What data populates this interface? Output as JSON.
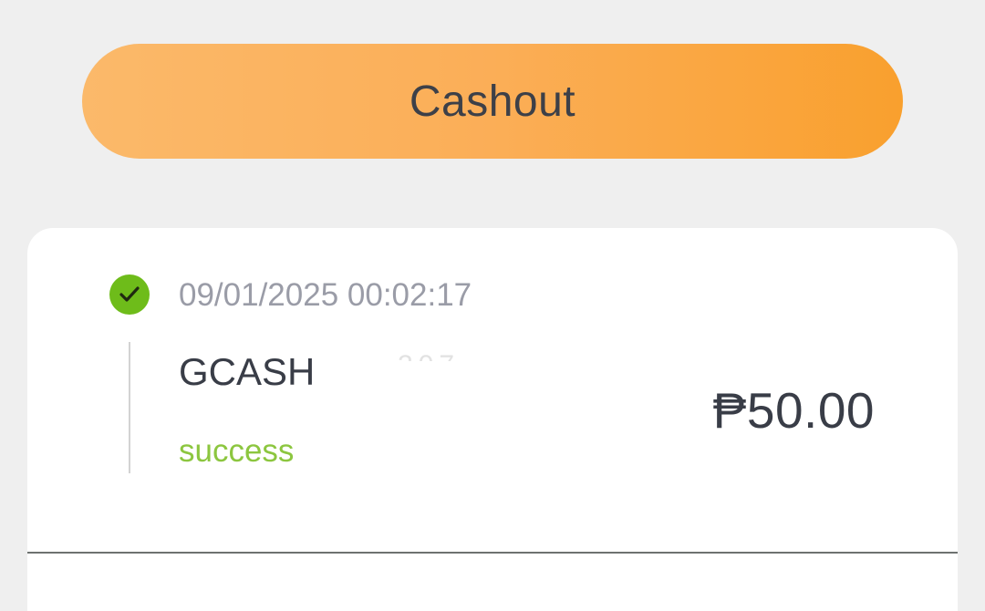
{
  "cashout_button": {
    "label": "Cashout",
    "gradient_start": "#fbb96a",
    "gradient_end": "#f9a02e"
  },
  "transaction": {
    "status_icon": "check-circle-icon",
    "timestamp": "09/01/2025 00:02:17",
    "method": "GCASH",
    "masked_account": "207",
    "status": "success",
    "amount": "₱50.00",
    "success_color": "#8cc63f"
  }
}
